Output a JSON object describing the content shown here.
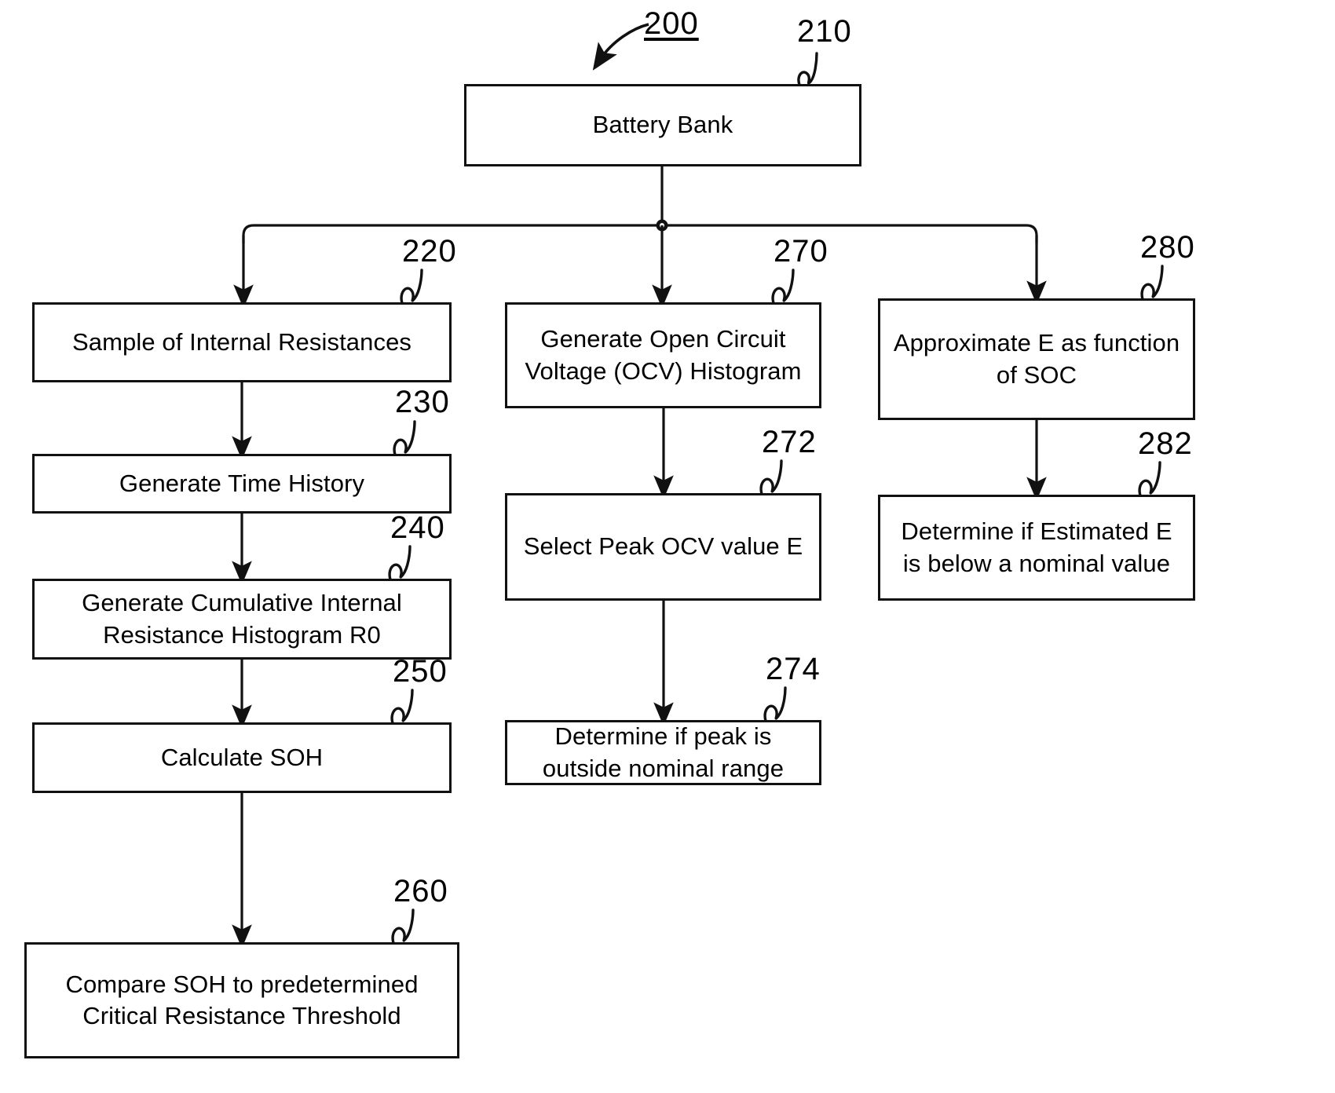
{
  "figure": {
    "main_ref": "200",
    "title_ref_underlined": true
  },
  "nodes": {
    "battery_bank": {
      "ref": "210",
      "label": "Battery Bank"
    },
    "sample_ir": {
      "ref": "220",
      "label": "Sample of Internal Resistances"
    },
    "time_history": {
      "ref": "230",
      "label": "Generate Time History"
    },
    "cum_hist": {
      "ref": "240",
      "line1": "Generate Cumulative Internal",
      "line2": "Resistance Histogram R0"
    },
    "calc_soh": {
      "ref": "250",
      "label": "Calculate SOH"
    },
    "compare_soh": {
      "ref": "260",
      "line1": "Compare SOH to predetermined",
      "line2": "Critical Resistance Threshold"
    },
    "ocv_hist": {
      "ref": "270",
      "line1": "Generate Open Circuit",
      "line2": "Voltage (OCV) Histogram"
    },
    "peak_ocv": {
      "ref": "272",
      "label": "Select Peak OCV value E"
    },
    "peak_range": {
      "ref": "274",
      "line1": "Determine if peak is",
      "line2": "outside nominal range"
    },
    "approx_e": {
      "ref": "280",
      "line1": "Approximate E as function",
      "line2": "of SOC"
    },
    "estimated_e": {
      "ref": "282",
      "line1": "Determine if Estimated E",
      "line2": "is below a nominal value"
    }
  },
  "colors": {
    "line": "#111111",
    "background": "#ffffff",
    "text": "#000000"
  },
  "chart_data": {
    "type": "diagram",
    "title": "Battery State of Health / State of Charge determination flowchart",
    "nodes": [
      {
        "ref": "200",
        "label": "200",
        "role": "figure-callout"
      },
      {
        "ref": "210",
        "label": "Battery Bank",
        "role": "source"
      },
      {
        "ref": "220",
        "label": "Sample of Internal Resistances",
        "role": "process"
      },
      {
        "ref": "230",
        "label": "Generate Time History",
        "role": "process"
      },
      {
        "ref": "240",
        "label": "Generate Cumulative Internal Resistance Histogram R0",
        "role": "process"
      },
      {
        "ref": "250",
        "label": "Calculate SOH",
        "role": "process"
      },
      {
        "ref": "260",
        "label": "Compare SOH to predetermined Critical Resistance Threshold",
        "role": "process"
      },
      {
        "ref": "270",
        "label": "Generate Open Circuit Voltage (OCV) Histogram",
        "role": "process"
      },
      {
        "ref": "272",
        "label": "Select Peak OCV value E",
        "role": "process"
      },
      {
        "ref": "274",
        "label": "Determine if peak is outside nominal range",
        "role": "decision-process"
      },
      {
        "ref": "280",
        "label": "Approximate E as function of SOC",
        "role": "process"
      },
      {
        "ref": "282",
        "label": "Determine if Estimated E is below a nominal value",
        "role": "decision-process"
      }
    ],
    "edges": [
      {
        "from": "210",
        "to": "bus",
        "style": "solid-arrow"
      },
      {
        "from": "bus",
        "to": "220",
        "style": "solid-arrow"
      },
      {
        "from": "bus",
        "to": "270",
        "style": "solid-arrow"
      },
      {
        "from": "bus",
        "to": "280",
        "style": "solid-arrow"
      },
      {
        "from": "220",
        "to": "230",
        "style": "solid-arrow"
      },
      {
        "from": "230",
        "to": "240",
        "style": "solid-arrow"
      },
      {
        "from": "240",
        "to": "250",
        "style": "solid-arrow"
      },
      {
        "from": "250",
        "to": "260",
        "style": "solid-arrow"
      },
      {
        "from": "270",
        "to": "272",
        "style": "solid-arrow"
      },
      {
        "from": "272",
        "to": "274",
        "style": "solid-arrow"
      },
      {
        "from": "280",
        "to": "282",
        "style": "solid-arrow"
      }
    ]
  }
}
